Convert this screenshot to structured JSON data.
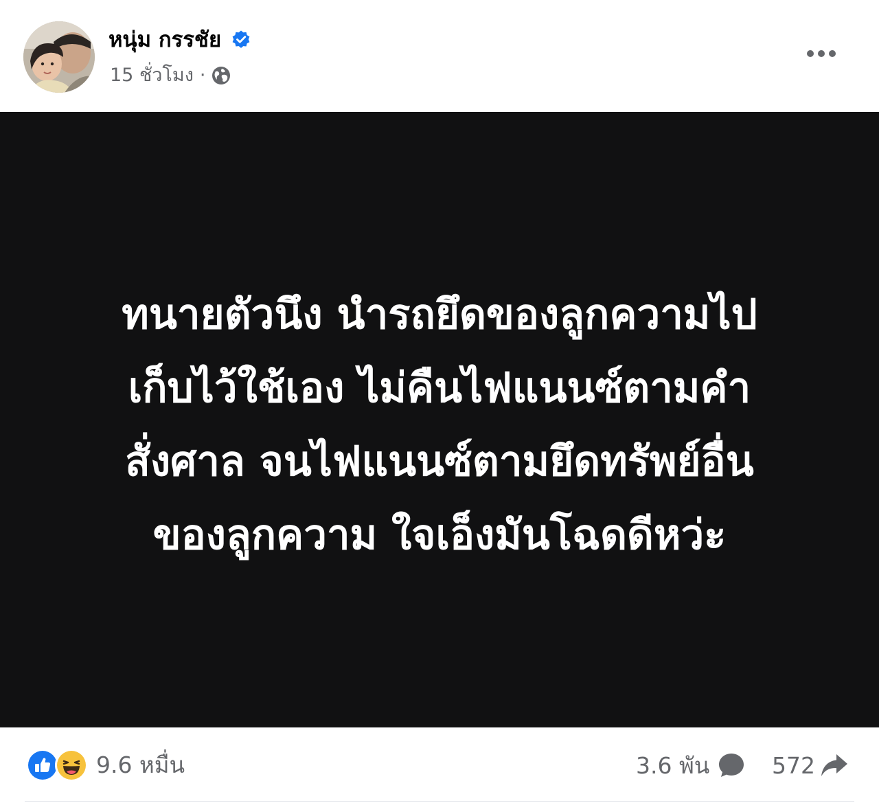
{
  "post": {
    "author": "หนุ่ม กรรชัย",
    "time": "15 ชั่วโมง",
    "separator": "·",
    "privacy_icon": "globe-icon",
    "verified_icon": "verified-badge-icon",
    "more_icon": "more-horizontal-icon"
  },
  "image": {
    "lines": [
      "ทนายตัวนึง นำรถยึดของลูกความไป",
      "เก็บไว้ใช้เอง ไม่คืนไฟแนนซ์ตามคำ",
      "สั่งศาล จนไฟแนนซ์ตามยึดทรัพย์อื่น",
      "ของลูกความ ใจเอ็งมันโฉดดีหว่ะ"
    ],
    "background": "#111112",
    "text_color": "#ffffff"
  },
  "footer": {
    "reaction_icons": [
      "like-icon",
      "haha-icon"
    ],
    "reaction_count": "9.6 หมื่น",
    "comment_count": "3.6 พัน",
    "share_count": "572"
  },
  "colors": {
    "like_blue": "#1877f2",
    "verified_blue": "#1877f2",
    "haha_yellow": "#f7c23c",
    "muted_text": "#65676b"
  }
}
